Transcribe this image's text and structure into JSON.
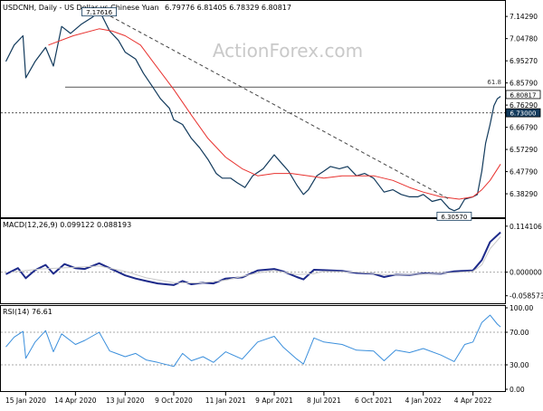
{
  "header": {
    "symbol_line": "USDCNH, Daily - US Dollar vs Chinese Yuan",
    "ohlc": "6.79776 6.81405 6.78329 6.80817"
  },
  "watermark": "ActionForex.com",
  "colors": {
    "price": "#123a5c",
    "sma": "#e8322f",
    "trendline": "#444444",
    "macd": "#1d2a8a",
    "macd_signal": "#c9c9c9",
    "rsi": "#3b8fdc",
    "price_label_bg": "#123a5c"
  },
  "chart_data": [
    {
      "type": "line",
      "panel": "price",
      "x": [
        "15 Jan 2020",
        "14 Apr 2020",
        "13 Jul 2020",
        "9 Oct 2020",
        "11 Jan 2021",
        "9 Apr 2021",
        "8 Jul 2021",
        "6 Oct 2021",
        "4 Jan 2022",
        "4 Apr 2022"
      ],
      "x_labels": [
        "15 Jan 2020",
        "14 Apr 2020",
        "13 Jul 2020",
        "9 Oct 2020",
        "11 Jan 2021",
        "9 Apr 2021",
        "8 Jul 2021",
        "6 Oct 2021",
        "4 Jan 2022",
        "4 Apr 2022"
      ],
      "ylim": [
        6.29,
        7.19
      ],
      "y_ticks": [
        "7.14290",
        "7.04780",
        "6.95270",
        "6.85790",
        "6.76290",
        "6.66790",
        "6.57290",
        "6.47790",
        "6.38290"
      ],
      "series": [
        {
          "style": "price",
          "points": [
            [
              "2019-12-10",
              6.95
            ],
            [
              "2019-12-25",
              7.02
            ],
            [
              "2020-01-10",
              7.06
            ],
            [
              "2020-01-15",
              6.88
            ],
            [
              "2020-02-01",
              6.95
            ],
            [
              "2020-02-20",
              7.01
            ],
            [
              "2020-03-05",
              6.93
            ],
            [
              "2020-03-20",
              7.1
            ],
            [
              "2020-04-05",
              7.07
            ],
            [
              "2020-04-25",
              7.11
            ],
            [
              "2020-05-15",
              7.14
            ],
            [
              "2020-05-27",
              7.17
            ],
            [
              "2020-06-15",
              7.08
            ],
            [
              "2020-07-01",
              7.04
            ],
            [
              "2020-07-13",
              6.99
            ],
            [
              "2020-08-01",
              6.96
            ],
            [
              "2020-08-15",
              6.9
            ],
            [
              "2020-09-01",
              6.84
            ],
            [
              "2020-09-15",
              6.79
            ],
            [
              "2020-10-01",
              6.75
            ],
            [
              "2020-10-09",
              6.7
            ],
            [
              "2020-10-25",
              6.68
            ],
            [
              "2020-11-10",
              6.62
            ],
            [
              "2020-11-25",
              6.58
            ],
            [
              "2020-12-10",
              6.53
            ],
            [
              "2020-12-25",
              6.47
            ],
            [
              "2021-01-05",
              6.45
            ],
            [
              "2021-01-20",
              6.45
            ],
            [
              "2021-02-01",
              6.43
            ],
            [
              "2021-02-15",
              6.41
            ],
            [
              "2021-03-01",
              6.46
            ],
            [
              "2021-03-20",
              6.49
            ],
            [
              "2021-04-09",
              6.55
            ],
            [
              "2021-04-20",
              6.52
            ],
            [
              "2021-05-05",
              6.48
            ],
            [
              "2021-05-20",
              6.42
            ],
            [
              "2021-06-01",
              6.38
            ],
            [
              "2021-06-10",
              6.4
            ],
            [
              "2021-06-25",
              6.46
            ],
            [
              "2021-07-08",
              6.48
            ],
            [
              "2021-07-20",
              6.5
            ],
            [
              "2021-08-05",
              6.49
            ],
            [
              "2021-08-20",
              6.5
            ],
            [
              "2021-09-05",
              6.46
            ],
            [
              "2021-09-20",
              6.47
            ],
            [
              "2021-10-06",
              6.45
            ],
            [
              "2021-10-25",
              6.39
            ],
            [
              "2021-11-10",
              6.4
            ],
            [
              "2021-11-25",
              6.38
            ],
            [
              "2021-12-10",
              6.37
            ],
            [
              "2021-12-25",
              6.37
            ],
            [
              "2022-01-04",
              6.38
            ],
            [
              "2022-01-20",
              6.35
            ],
            [
              "2022-02-05",
              6.36
            ],
            [
              "2022-02-20",
              6.32
            ],
            [
              "2022-03-01",
              6.31
            ],
            [
              "2022-03-10",
              6.32
            ],
            [
              "2022-03-20",
              6.36
            ],
            [
              "2022-04-04",
              6.37
            ],
            [
              "2022-04-12",
              6.38
            ],
            [
              "2022-04-20",
              6.48
            ],
            [
              "2022-04-27",
              6.6
            ],
            [
              "2022-05-05",
              6.68
            ],
            [
              "2022-05-12",
              6.76
            ],
            [
              "2022-05-18",
              6.79
            ],
            [
              "2022-05-24",
              6.8
            ]
          ]
        },
        {
          "style": "sma",
          "points": [
            [
              "2020-02-25",
              7.02
            ],
            [
              "2020-04-10",
              7.06
            ],
            [
              "2020-05-27",
              7.09
            ],
            [
              "2020-06-20",
              7.08
            ],
            [
              "2020-07-13",
              7.06
            ],
            [
              "2020-08-10",
              7.02
            ],
            [
              "2020-09-01",
              6.95
            ],
            [
              "2020-10-09",
              6.83
            ],
            [
              "2020-11-10",
              6.72
            ],
            [
              "2020-12-10",
              6.62
            ],
            [
              "2021-01-11",
              6.54
            ],
            [
              "2021-02-10",
              6.49
            ],
            [
              "2021-03-10",
              6.46
            ],
            [
              "2021-04-09",
              6.47
            ],
            [
              "2021-05-10",
              6.47
            ],
            [
              "2021-06-10",
              6.46
            ],
            [
              "2021-07-08",
              6.45
            ],
            [
              "2021-08-10",
              6.46
            ],
            [
              "2021-09-10",
              6.46
            ],
            [
              "2021-10-06",
              6.46
            ],
            [
              "2021-11-10",
              6.44
            ],
            [
              "2021-12-10",
              6.41
            ],
            [
              "2022-01-04",
              6.39
            ],
            [
              "2022-02-05",
              6.37
            ],
            [
              "2022-03-10",
              6.36
            ],
            [
              "2022-04-04",
              6.37
            ],
            [
              "2022-04-20",
              6.4
            ],
            [
              "2022-05-05",
              6.44
            ],
            [
              "2022-05-24",
              6.51
            ]
          ]
        },
        {
          "style": "trendline",
          "points": [
            [
              "2020-05-27",
              7.17
            ],
            [
              "2022-02-20",
              6.36
            ]
          ]
        }
      ],
      "horizontal_lines": [
        {
          "value": 6.84,
          "label": "61.8",
          "style": "solid"
        },
        {
          "value": 6.73,
          "style": "dashed"
        }
      ],
      "price_labels": [
        {
          "date": "2020-05-27",
          "value": 7.17,
          "text": "7.17616"
        },
        {
          "date": "2022-03-01",
          "value": 6.31,
          "text": "6.30570"
        },
        {
          "axis_value": 6.80817,
          "text": "6.80817"
        },
        {
          "axis_value": 6.73,
          "text": "6.73000"
        }
      ]
    },
    {
      "type": "line",
      "panel": "macd",
      "title": "MACD(12,26,9) 0.099122 0.088193",
      "ylim": [
        -0.075,
        0.125
      ],
      "y_ticks": [
        "0.114106",
        "0.000000",
        "-0.058573"
      ],
      "series": [
        {
          "style": "macd",
          "points": [
            [
              "2019-12-10",
              -0.005
            ],
            [
              "2020-01-01",
              0.01
            ],
            [
              "2020-01-15",
              -0.015
            ],
            [
              "2020-02-01",
              0.005
            ],
            [
              "2020-02-20",
              0.018
            ],
            [
              "2020-03-05",
              -0.004
            ],
            [
              "2020-03-25",
              0.02
            ],
            [
              "2020-04-14",
              0.01
            ],
            [
              "2020-05-01",
              0.008
            ],
            [
              "2020-05-27",
              0.022
            ],
            [
              "2020-06-15",
              0.01
            ],
            [
              "2020-07-13",
              -0.008
            ],
            [
              "2020-08-01",
              -0.016
            ],
            [
              "2020-08-20",
              -0.022
            ],
            [
              "2020-09-10",
              -0.028
            ],
            [
              "2020-10-09",
              -0.032
            ],
            [
              "2020-10-25",
              -0.022
            ],
            [
              "2020-11-10",
              -0.03
            ],
            [
              "2020-12-01",
              -0.026
            ],
            [
              "2020-12-20",
              -0.028
            ],
            [
              "2021-01-11",
              -0.016
            ],
            [
              "2021-02-10",
              -0.013
            ],
            [
              "2021-03-10",
              0.004
            ],
            [
              "2021-04-09",
              0.008
            ],
            [
              "2021-04-25",
              0.002
            ],
            [
              "2021-05-20",
              -0.012
            ],
            [
              "2021-06-01",
              -0.018
            ],
            [
              "2021-06-20",
              0.006
            ],
            [
              "2021-07-08",
              0.005
            ],
            [
              "2021-08-10",
              0.003
            ],
            [
              "2021-09-05",
              -0.002
            ],
            [
              "2021-10-06",
              -0.004
            ],
            [
              "2021-10-25",
              -0.012
            ],
            [
              "2021-11-15",
              -0.006
            ],
            [
              "2021-12-10",
              -0.007
            ],
            [
              "2022-01-04",
              -0.003
            ],
            [
              "2022-02-05",
              -0.004
            ],
            [
              "2022-03-01",
              0.002
            ],
            [
              "2022-04-04",
              0.004
            ],
            [
              "2022-04-20",
              0.03
            ],
            [
              "2022-05-05",
              0.075
            ],
            [
              "2022-05-24",
              0.099
            ]
          ]
        },
        {
          "style": "macd_signal",
          "points": [
            [
              "2019-12-20",
              0.0
            ],
            [
              "2020-02-10",
              0.008
            ],
            [
              "2020-04-14",
              0.012
            ],
            [
              "2020-05-27",
              0.015
            ],
            [
              "2020-07-13",
              0.002
            ],
            [
              "2020-08-20",
              -0.014
            ],
            [
              "2020-10-09",
              -0.026
            ],
            [
              "2020-11-25",
              -0.027
            ],
            [
              "2021-01-11",
              -0.02
            ],
            [
              "2021-03-10",
              -0.002
            ],
            [
              "2021-04-09",
              0.004
            ],
            [
              "2021-05-20",
              -0.006
            ],
            [
              "2021-06-20",
              -0.004
            ],
            [
              "2021-07-08",
              0.002
            ],
            [
              "2021-09-05",
              0.0
            ],
            [
              "2021-10-25",
              -0.006
            ],
            [
              "2021-12-10",
              -0.006
            ],
            [
              "2022-02-05",
              -0.003
            ],
            [
              "2022-04-04",
              0.002
            ],
            [
              "2022-04-20",
              0.018
            ],
            [
              "2022-05-05",
              0.058
            ],
            [
              "2022-05-24",
              0.088
            ]
          ]
        }
      ]
    },
    {
      "type": "line",
      "panel": "rsi",
      "title": "RSI(14) 76.61",
      "ylim": [
        0,
        100
      ],
      "y_ticks": [
        "100.00",
        "70.00",
        "30.00",
        "0.00"
      ],
      "levels": [
        70,
        30
      ],
      "series": [
        {
          "style": "rsi",
          "points": [
            [
              "2019-12-10",
              52
            ],
            [
              "2019-12-25",
              64
            ],
            [
              "2020-01-10",
              71
            ],
            [
              "2020-01-15",
              38
            ],
            [
              "2020-02-01",
              58
            ],
            [
              "2020-02-20",
              72
            ],
            [
              "2020-03-05",
              46
            ],
            [
              "2020-03-20",
              68
            ],
            [
              "2020-04-14",
              55
            ],
            [
              "2020-05-01",
              60
            ],
            [
              "2020-05-27",
              70
            ],
            [
              "2020-06-15",
              47
            ],
            [
              "2020-07-13",
              40
            ],
            [
              "2020-08-01",
              44
            ],
            [
              "2020-08-20",
              36
            ],
            [
              "2020-09-10",
              33
            ],
            [
              "2020-10-09",
              28
            ],
            [
              "2020-10-25",
              44
            ],
            [
              "2020-11-10",
              35
            ],
            [
              "2020-12-01",
              40
            ],
            [
              "2020-12-20",
              33
            ],
            [
              "2021-01-11",
              46
            ],
            [
              "2021-02-10",
              37
            ],
            [
              "2021-03-10",
              58
            ],
            [
              "2021-04-09",
              65
            ],
            [
              "2021-04-25",
              52
            ],
            [
              "2021-05-20",
              37
            ],
            [
              "2021-06-01",
              31
            ],
            [
              "2021-06-20",
              63
            ],
            [
              "2021-07-08",
              58
            ],
            [
              "2021-08-10",
              55
            ],
            [
              "2021-09-05",
              48
            ],
            [
              "2021-10-06",
              47
            ],
            [
              "2021-10-25",
              35
            ],
            [
              "2021-11-15",
              48
            ],
            [
              "2021-12-10",
              45
            ],
            [
              "2022-01-04",
              50
            ],
            [
              "2022-02-05",
              42
            ],
            [
              "2022-03-01",
              34
            ],
            [
              "2022-03-20",
              55
            ],
            [
              "2022-04-04",
              58
            ],
            [
              "2022-04-20",
              82
            ],
            [
              "2022-05-05",
              91
            ],
            [
              "2022-05-18",
              80
            ],
            [
              "2022-05-24",
              76.61
            ]
          ]
        }
      ]
    }
  ]
}
